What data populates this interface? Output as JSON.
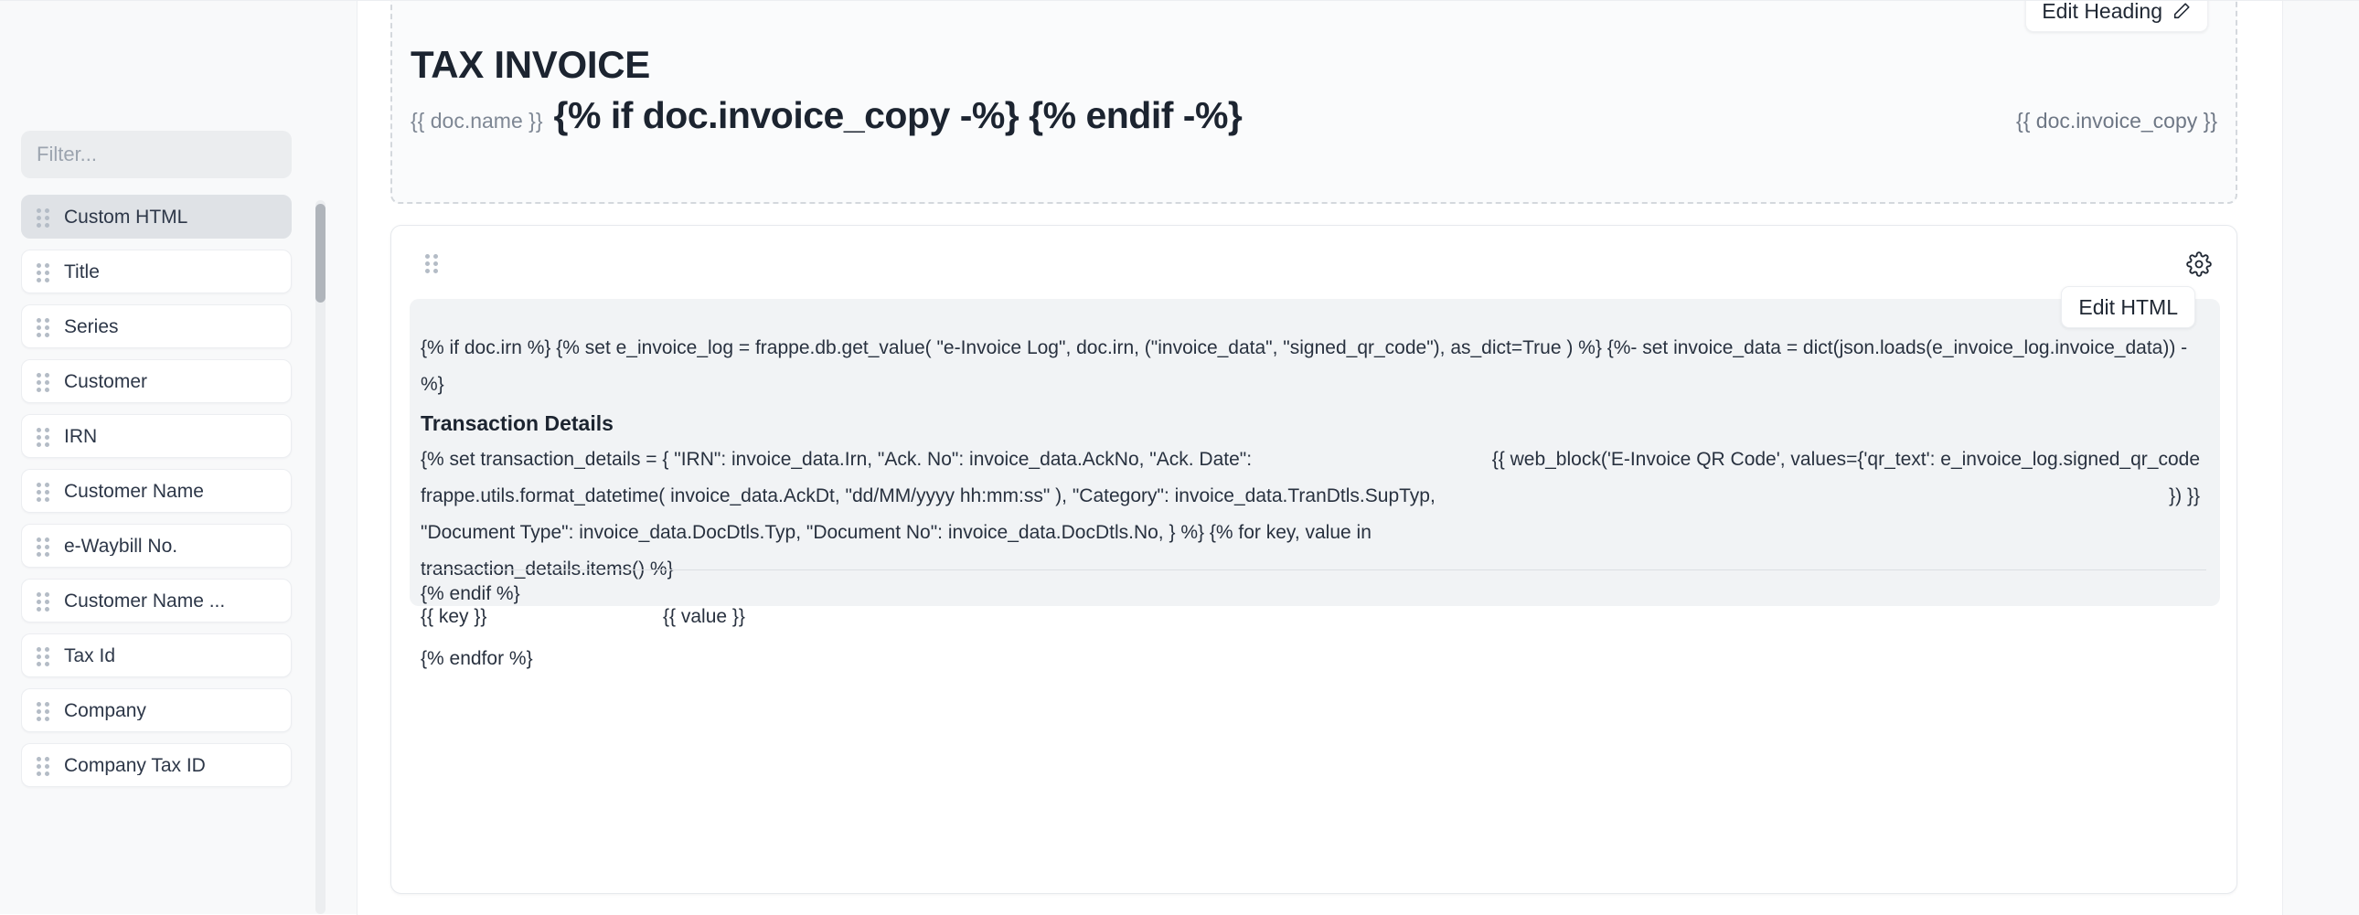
{
  "sidebar": {
    "filter": {
      "placeholder": "Filter...",
      "value": ""
    },
    "items": [
      {
        "label": "Custom HTML",
        "active": true
      },
      {
        "label": "Title",
        "active": false
      },
      {
        "label": "Series",
        "active": false
      },
      {
        "label": "Customer",
        "active": false
      },
      {
        "label": "IRN",
        "active": false
      },
      {
        "label": "Customer Name",
        "active": false
      },
      {
        "label": "e-Waybill No.",
        "active": false
      },
      {
        "label": "Customer Name ...",
        "active": false
      },
      {
        "label": "Tax Id",
        "active": false
      },
      {
        "label": "Company",
        "active": false
      },
      {
        "label": "Company Tax ID",
        "active": false
      }
    ]
  },
  "heading_block": {
    "edit_heading_label": "Edit Heading",
    "edit_heading_icon": "pencil-icon",
    "title": "TAX INVOICE",
    "doc_name_tag": "{{ doc.name }}",
    "jinja_conditional": "{% if doc.invoice_copy -%} {% endif -%}",
    "doc_invoice_copy_tag": "{{ doc.invoice_copy }}"
  },
  "section": {
    "drag_handle_icon": "drag-handle-icon",
    "settings_icon": "gear-icon",
    "html_block": {
      "edit_html_label": "Edit HTML",
      "line_1": "{% if doc.irn %} {% set e_invoice_log = frappe.db.get_value( \"e-Invoice Log\", doc.irn, (\"invoice_data\", \"signed_qr_code\"), as_dict=True ) %} {%- set invoice_data = dict(json.loads(e_invoice_log.invoice_data)) -%}",
      "transaction_details_heading": "Transaction Details",
      "line_2": "{% set transaction_details = { \"IRN\": invoice_data.Irn, \"Ack. No\": invoice_data.AckNo, \"Ack. Date\": frappe.utils.format_datetime( invoice_data.AckDt, \"dd/MM/yyyy hh:mm:ss\" ), \"Category\": invoice_data.TranDtls.SupTyp, \"Document Type\": invoice_data.DocDtls.Typ, \"Document No\": invoice_data.DocDtls.No, } %} {% for key, value in transaction_details.items() %}",
      "qr_block_line": "{{ web_block('E-Invoice QR Code', values={'qr_text': e_invoice_log.signed_qr_code }) }}",
      "key_placeholder": "{{ key }}",
      "value_placeholder": "{{ value }}",
      "endfor_line": "{% endfor %}",
      "endif_line": "{% endif %}"
    }
  },
  "colors": {
    "page_bg": "#ffffff",
    "sidebar_bg": "#f8f9fa",
    "code_block_bg": "#f1f3f5",
    "active_item_bg": "#dfe2e6",
    "text": "#28313f",
    "muted_text": "#7e8794"
  }
}
